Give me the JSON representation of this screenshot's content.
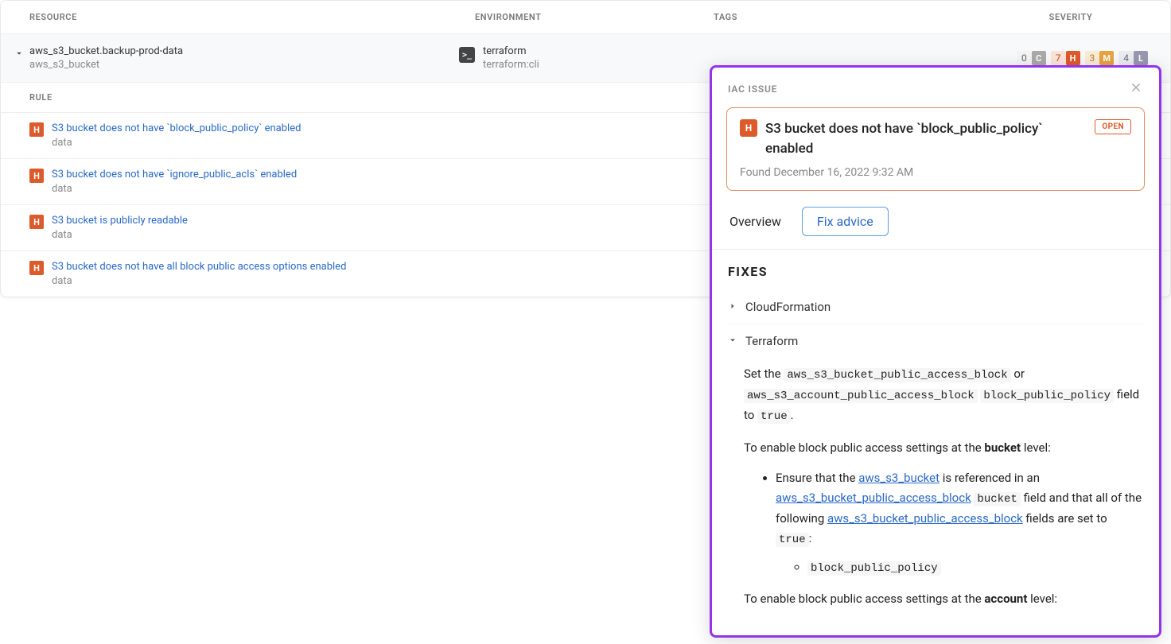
{
  "table": {
    "headers": {
      "resource": "RESOURCE",
      "environment": "ENVIRONMENT",
      "tags": "TAGS",
      "severity": "SEVERITY"
    },
    "resource": {
      "name": "aws_s3_bucket.backup-prod-data",
      "type": "aws_s3_bucket",
      "env_name": "terraform",
      "env_sub": "terraform:cli"
    },
    "severity": {
      "c": {
        "count": "0",
        "letter": "C"
      },
      "h": {
        "count": "7",
        "letter": "H"
      },
      "m": {
        "count": "3",
        "letter": "M"
      },
      "l": {
        "count": "4",
        "letter": "L"
      }
    },
    "rules_header": "RULE",
    "rules": [
      {
        "title": "S3 bucket does not have `block_public_policy` enabled",
        "sub": "data"
      },
      {
        "title": "S3 bucket does not have `ignore_public_acls` enabled",
        "sub": "data"
      },
      {
        "title": "S3 bucket is publicly readable",
        "sub": "data"
      },
      {
        "title": "S3 bucket does not have all block public access options enabled",
        "sub": "data"
      }
    ]
  },
  "panel": {
    "header": "IAC ISSUE",
    "issue": {
      "severity_letter": "H",
      "title": "S3 bucket does not have `block_public_policy` enabled",
      "status": "OPEN",
      "found": "Found December 16, 2022 9:32 AM"
    },
    "tabs": {
      "overview": "Overview",
      "fix": "Fix advice"
    },
    "fixes": {
      "title": "FIXES",
      "cloudformation": "CloudFormation",
      "terraform": "Terraform"
    },
    "terraform_fix": {
      "p1_prefix": "Set the ",
      "p1_code1": "aws_s3_bucket_public_access_block",
      "p1_mid": " or ",
      "p1_code2": "aws_s3_account_public_access_block",
      "p1_sep": " ",
      "p1_code3": "block_public_policy",
      "p1_mid2": " field to ",
      "p1_code4": "true",
      "p1_suffix": ".",
      "p2_prefix": "To enable block public access settings at the ",
      "p2_bold": "bucket",
      "p2_suffix": " level:",
      "li1_prefix": "Ensure that the ",
      "li1_link1": "aws_s3_bucket",
      "li1_mid1": " is referenced in an ",
      "li1_link2": "aws_s3_bucket_public_access_block",
      "li1_mid2": " ",
      "li1_code1": "bucket",
      "li1_mid3": " field and that all of the following ",
      "li1_link3": "aws_s3_bucket_public_access_block",
      "li1_mid4": " fields are set to ",
      "li1_code2": "true",
      "li1_suffix": ":",
      "sub_li": "block_public_policy",
      "p3_prefix": "To enable block public access settings at the ",
      "p3_bold": "account",
      "p3_suffix": " level:"
    }
  }
}
